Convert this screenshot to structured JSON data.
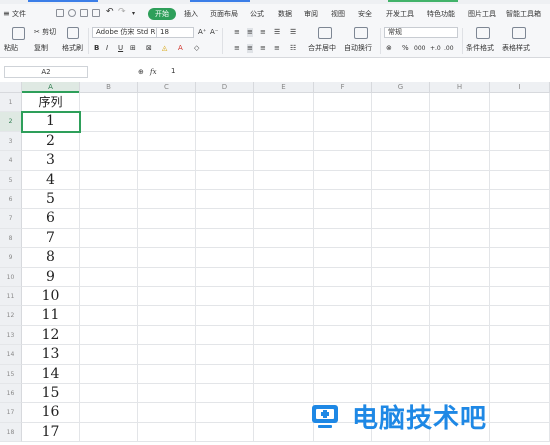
{
  "menubar": {
    "file": "文件",
    "tabs": [
      "开始",
      "插入",
      "页面布局",
      "公式",
      "数据",
      "审阅",
      "视图",
      "安全",
      "开发工具",
      "特色功能",
      "图片工具",
      "智能工具箱"
    ]
  },
  "ribbon": {
    "paste": "粘贴",
    "cut": "剪切",
    "copy": "复制",
    "format_painter": "格式刷",
    "font": "Adobe 仿宋 Std R",
    "font_size": "18",
    "merge_center": "合并居中",
    "wrap_text": "自动换行",
    "number_format": "常规",
    "conditional_format": "条件格式",
    "table_style": "表格样式"
  },
  "formula_bar": {
    "cell_ref": "A2",
    "fx_label": "fx",
    "value": "1"
  },
  "sheet": {
    "columns": [
      "A",
      "B",
      "C",
      "D",
      "E",
      "F",
      "G",
      "H",
      "I"
    ],
    "rows": [
      "1",
      "2",
      "3",
      "4",
      "5",
      "6",
      "7",
      "8",
      "9",
      "10",
      "11",
      "12",
      "13",
      "14",
      "15",
      "16",
      "17",
      "18"
    ],
    "column_a": [
      "序列",
      "1",
      "2",
      "3",
      "4",
      "5",
      "6",
      "7",
      "8",
      "9",
      "10",
      "11",
      "12",
      "13",
      "14",
      "15",
      "16",
      "17"
    ],
    "selected_cell": "A2",
    "accent_color": "#2e9f5a"
  },
  "watermark": {
    "text": "电脑技术吧",
    "color": "#1e88e5"
  }
}
